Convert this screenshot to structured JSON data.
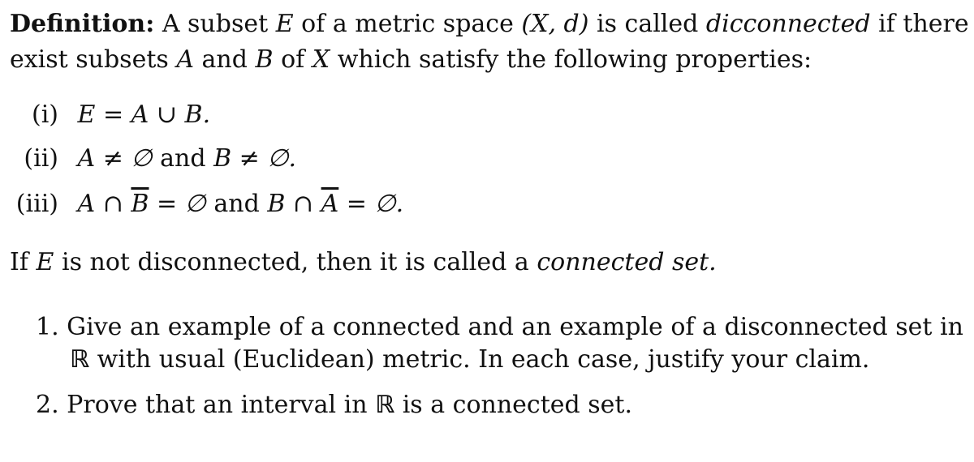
{
  "definition": {
    "label": "Definition:",
    "line1_a": "A subset",
    "E": "E",
    "line1_b": "of a metric space",
    "space": "(X, d)",
    "line1_c": "is called",
    "term": "dicconnected",
    "line1_d": "if there",
    "line2_a": "exist subsets",
    "A": "A",
    "and": "and",
    "B": "B",
    "line2_b": "of",
    "X": "X",
    "line2_c": "which satisfy the following properties:"
  },
  "properties": [
    {
      "label": "(i)",
      "expr": "E = A ∪ B."
    },
    {
      "label": "(ii)",
      "expr_a": "A ≠ ∅",
      "and": "and",
      "expr_b": "B ≠ ∅."
    },
    {
      "label": "(iii)",
      "a1": "A ∩ ",
      "b1": "B",
      "a2": " = ∅",
      "and": "and",
      "a3": "B ∩ ",
      "b2": "A",
      "a4": " = ∅."
    }
  ],
  "connected_def": {
    "a": "If",
    "E": "E",
    "b": "is not disconnected, then it is called a",
    "term": "connected set."
  },
  "questions": [
    {
      "num": "1.",
      "line1": "Give an example of a connected and an example of a disconnected set in",
      "R": "ℝ",
      "line2": "with usual (Euclidean) metric. In each case, justify your claim."
    },
    {
      "num": "2.",
      "a": "Prove that an interval in",
      "R": "ℝ",
      "b": "is a connected set."
    }
  ]
}
